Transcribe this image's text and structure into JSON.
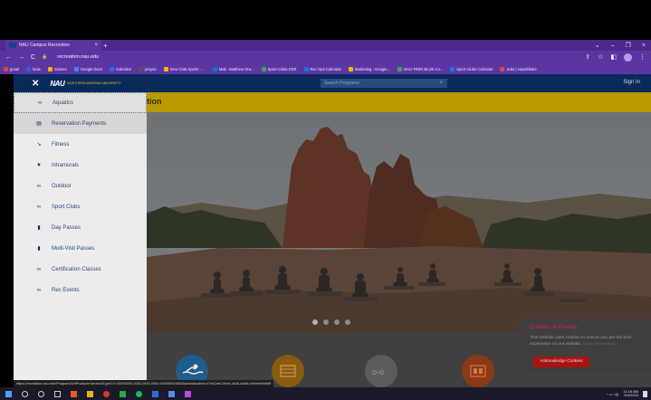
{
  "browser": {
    "tab_title": "NAU Campus Recreation",
    "tab_close": "×",
    "new_tab": "+",
    "window_controls": [
      "⌄",
      "–",
      "❐",
      "×"
    ],
    "url": "recreation.nau.edu",
    "nav_icons": [
      "←",
      "→",
      "C",
      "🔒"
    ],
    "bookmarks": [
      {
        "label": "gmail",
        "color": "#ea4335"
      },
      {
        "label": "louie",
        "color": "#2a64d6"
      },
      {
        "label": "Sixteen",
        "color": "#f4b400"
      },
      {
        "label": "Google Docs",
        "color": "#4285f4"
      },
      {
        "label": "Calendar",
        "color": "#1a73e8"
      },
      {
        "label": "proyso",
        "color": "#555555"
      },
      {
        "label": "NAU Club Sports - ...",
        "color": "#f4b400"
      },
      {
        "label": "Mail - Matthew Ora...",
        "color": "#0078d4"
      },
      {
        "label": "Sport Clubs DSR",
        "color": "#34a853"
      },
      {
        "label": "Rec Ops Calendar",
        "color": "#1a73e8"
      },
      {
        "label": "Marketing - Google...",
        "color": "#f4b400"
      },
      {
        "label": "NAU TREK BLUE Co...",
        "color": "#34a853"
      },
      {
        "label": "Sport Clubs Calendar",
        "color": "#1a73e8"
      },
      {
        "label": "Jobs | Handshake",
        "color": "#ea4335"
      }
    ]
  },
  "site": {
    "search_placeholder": "Search Programs",
    "search_icon": "⌕",
    "signin": "Sign In",
    "title_fragment": "tion",
    "logo_mark": "NAU",
    "logo_text": "NORTHERN ARIZONA UNIVERSITY",
    "close_icon": "✕"
  },
  "nav": {
    "items": [
      {
        "label": "Aquatics",
        "icon": "∞",
        "state": "active"
      },
      {
        "label": "Reservation Payments",
        "icon": "▤",
        "state": "hover"
      },
      {
        "label": "Fitness",
        "icon": "↘",
        "state": ""
      },
      {
        "label": "Intramurals",
        "icon": "▼",
        "state": ""
      },
      {
        "label": "Outdoor",
        "icon": "∞",
        "state": ""
      },
      {
        "label": "Sport Clubs",
        "icon": "∞",
        "state": ""
      },
      {
        "label": "Day Passes",
        "icon": "▮",
        "state": ""
      },
      {
        "label": "Multi-Visit Passes",
        "icon": "▮",
        "state": ""
      },
      {
        "label": "Certification Classes",
        "icon": "∞",
        "state": ""
      },
      {
        "label": "Rec Events",
        "icon": "∞",
        "state": ""
      }
    ]
  },
  "cookie": {
    "title": "Cookies & Privacy",
    "body": "This website uses cookies to ensure you get the best experience on our website.",
    "more": "More information",
    "button": "Acknowledge Cookies"
  },
  "status_url": "https://recreation.nau.edu/Program/GetProducts?productTypeCV=00000000-0000-0000-0000-000000003502&classification=c7d42ae2-50cb-4a26-b48d-cb9bebb9d96f",
  "taskbar": {
    "time": "11:18 AM",
    "date": "5/4/2023",
    "colors": {
      "accent": "#0b2a5c",
      "gold": "#b99a00",
      "purple": "#5b36a3"
    }
  }
}
